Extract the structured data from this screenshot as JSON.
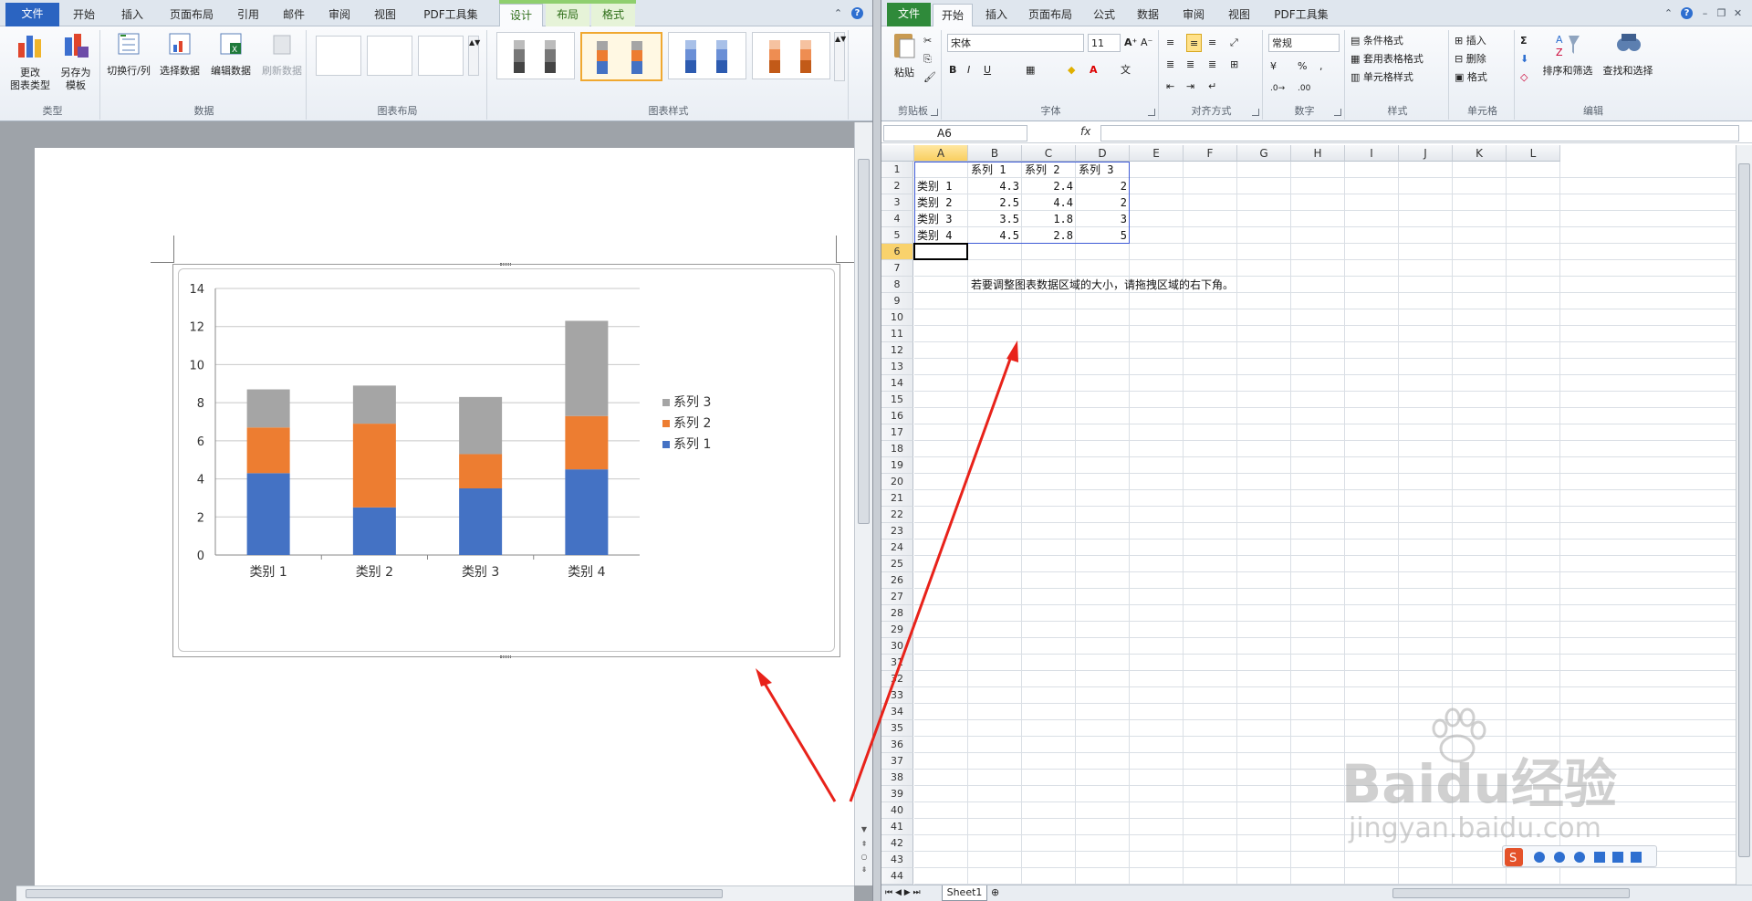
{
  "word": {
    "tabs": [
      "文件",
      "开始",
      "插入",
      "页面布局",
      "引用",
      "邮件",
      "审阅",
      "视图",
      "PDF工具集",
      "设计",
      "布局",
      "格式"
    ],
    "active_tab": "设计",
    "groups": {
      "type": {
        "label": "类型",
        "change_type": "更改\n图表类型",
        "save_template": "另存为\n模板"
      },
      "data": {
        "label": "数据",
        "switch": "切换行/列",
        "select": "选择数据",
        "edit": "编辑数据",
        "refresh": "刷新数据"
      },
      "layout": {
        "label": "图表布局"
      },
      "styles": {
        "label": "图表样式"
      }
    }
  },
  "chart_data": {
    "type": "bar",
    "stacked": true,
    "categories": [
      "类别 1",
      "类别 2",
      "类别 3",
      "类别 4"
    ],
    "series": [
      {
        "name": "系列 1",
        "values": [
          4.3,
          2.5,
          3.5,
          4.5
        ],
        "color": "#4472c4"
      },
      {
        "name": "系列 2",
        "values": [
          2.4,
          4.4,
          1.8,
          2.8
        ],
        "color": "#ed7d31"
      },
      {
        "name": "系列 3",
        "values": [
          2,
          2,
          3,
          5
        ],
        "color": "#a5a5a5"
      }
    ],
    "ylim": [
      0,
      14
    ],
    "yticks": [
      "0",
      "2",
      "4",
      "6",
      "8",
      "10",
      "12",
      "14"
    ],
    "grid": true,
    "legend": "right"
  },
  "excel": {
    "tabs": [
      "文件",
      "开始",
      "插入",
      "页面布局",
      "公式",
      "数据",
      "审阅",
      "视图",
      "PDF工具集"
    ],
    "active_tab": "开始",
    "ribbon": {
      "clipboard": {
        "label": "剪贴板",
        "paste": "粘贴"
      },
      "font": {
        "label": "字体",
        "name": "宋体",
        "size": "11"
      },
      "align": {
        "label": "对齐方式"
      },
      "number": {
        "label": "数字",
        "format": "常规"
      },
      "styles": {
        "label": "样式",
        "cond": "条件格式",
        "table": "套用表格格式",
        "cell": "单元格样式"
      },
      "cells": {
        "label": "单元格",
        "insert": "插入",
        "delete": "删除",
        "format": "格式"
      },
      "edit": {
        "label": "编辑",
        "sort": "排序和筛选",
        "find": "查找和选择"
      }
    },
    "namebox": "A6",
    "fx": "fx",
    "columns": [
      "A",
      "B",
      "C",
      "D",
      "E",
      "F",
      "G",
      "H",
      "I",
      "J",
      "K",
      "L"
    ],
    "rows": [
      "1",
      "2",
      "3",
      "4",
      "5",
      "6",
      "7",
      "8",
      "9",
      "10",
      "11",
      "12",
      "13",
      "14",
      "15",
      "16",
      "17",
      "18",
      "19",
      "20",
      "21",
      "22",
      "23",
      "24",
      "25",
      "26",
      "27",
      "28",
      "29",
      "30",
      "31",
      "32",
      "33",
      "34",
      "35",
      "36",
      "37",
      "38",
      "39",
      "40",
      "41",
      "42",
      "43",
      "44"
    ],
    "header_row": [
      "",
      "系列 1",
      "系列 2",
      "系列 3"
    ],
    "data_rows": [
      [
        "类别 1",
        "4.3",
        "2.4",
        "2"
      ],
      [
        "类别 2",
        "2.5",
        "4.4",
        "2"
      ],
      [
        "类别 3",
        "3.5",
        "1.8",
        "3"
      ],
      [
        "类别 4",
        "4.5",
        "2.8",
        "5"
      ]
    ],
    "note": "若要调整图表数据区域的大小，请拖拽区域的右下角。",
    "sheet_tab": "Sheet1"
  },
  "watermark": {
    "brand": "Baidu经验",
    "url": "jingyan.baidu.com"
  }
}
